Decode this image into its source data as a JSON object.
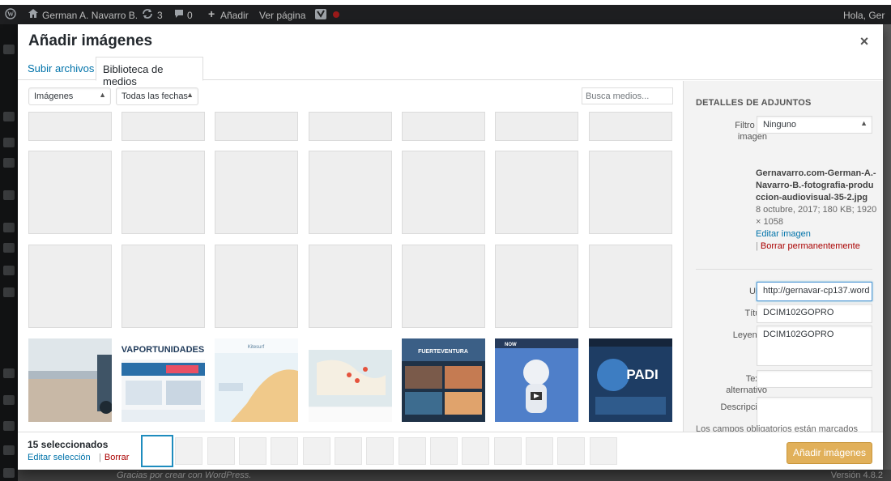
{
  "adminbar": {
    "site_name": "German A. Navarro B.",
    "updates_count": "3",
    "comments_count": "0",
    "new_label": "Añadir",
    "view_label": "Ver página",
    "greeting": "Hola, Ger"
  },
  "footer_bg": {
    "thanks": "Gracias por crear con WordPress.",
    "version": "Versión 4.8.2"
  },
  "modal": {
    "title": "Añadir imágenes",
    "close_icon": "close-icon",
    "tabs": [
      {
        "label": "Subir archivos"
      },
      {
        "label": "Biblioteca de medios"
      }
    ],
    "filters": {
      "type_value": "Imágenes",
      "date_value": "Todas las fechas",
      "search_placeholder": "Busca medios..."
    },
    "thumbnails": [
      {
        "caption": ""
      },
      {
        "caption": "VAPORTUNIDADES"
      },
      {
        "caption": "Kitesurf"
      },
      {
        "caption": ""
      },
      {
        "caption": "FUERTEVENTURA"
      },
      {
        "caption": "NOW"
      },
      {
        "caption": "PADI"
      }
    ]
  },
  "sidebar": {
    "heading": "DETALLES DE ADJUNTOS",
    "filter_label": "Filtro de imagen",
    "filter_value": "Ninguno",
    "filename": "Gernavarro.com-German-A.-Navarro-B.-fotografia-produccion-audiovisual-35-2.jpg",
    "meta": "8 octubre, 2017; 180 KB; 1920 × 1058",
    "edit_link": "Editar imagen",
    "delete_link": "Borrar permanentemente",
    "url_label": "URL",
    "url_value": "http://gernavar-cp137.word",
    "title_label": "Título",
    "title_value": "DCIM102GOPRO",
    "caption_label": "Leyenda",
    "caption_value": "DCIM102GOPRO",
    "alt_label": "Texto alternativo",
    "alt_value": "",
    "desc_label": "Descripción",
    "desc_value": "",
    "required_note": "Los campos obligatorios están marcados"
  },
  "footer": {
    "selected_count": "15 seleccionados",
    "edit_selection": "Editar selección",
    "clear": "Borrar",
    "submit": "Añadir imágenes"
  },
  "colors": {
    "accent_blue": "#0073aa",
    "delete_red": "#a00000",
    "primary_button": "#e1b05a",
    "adminbar_bg": "#1e1f21"
  }
}
